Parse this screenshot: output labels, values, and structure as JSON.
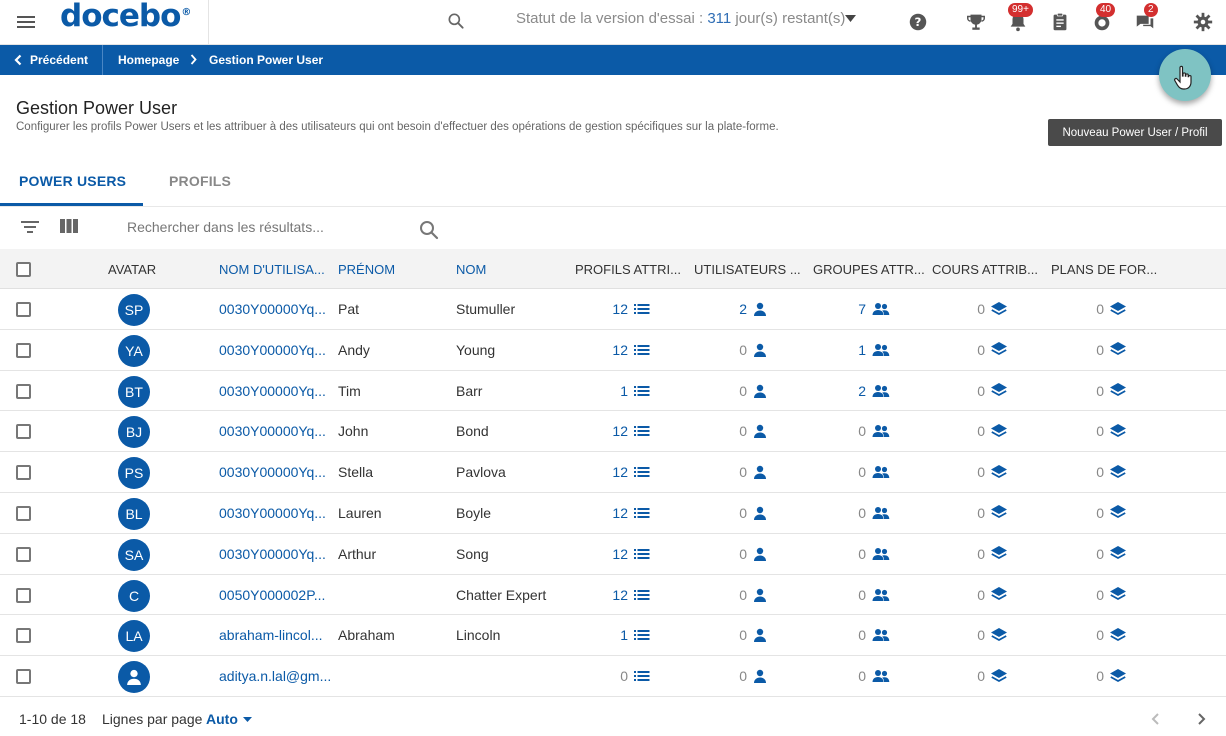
{
  "app": {
    "logo": "docebo",
    "logo_mark": "®",
    "trial_prefix": "Statut de la version d'essai : ",
    "trial_days": "311",
    "trial_suffix": " jour(s) restant(s)",
    "badges": {
      "notifications": "99+",
      "messages": "40",
      "chat": "2"
    }
  },
  "breadcrumb": {
    "back": "Précédent",
    "home": "Homepage",
    "current": "Gestion Power User"
  },
  "page": {
    "title": "Gestion Power User",
    "description": "Configurer les profils Power Users et les attribuer à des utilisateurs qui ont besoin d'effectuer des opérations de gestion spécifiques sur la plate-forme.",
    "new_button": "Nouveau Power User / Profil"
  },
  "tabs": [
    {
      "label": "POWER USERS"
    },
    {
      "label": "PROFILS"
    }
  ],
  "search": {
    "placeholder": "Rechercher dans les résultats..."
  },
  "table": {
    "columns": [
      "AVATAR",
      "NOM D'UTILISA...",
      "PRÉNOM",
      "NOM",
      "PROFILS ATTRI...",
      "UTILISATEURS ...",
      "GROUPES ATTR...",
      "COURS ATTRIB...",
      "PLANS DE FOR..."
    ],
    "rows": [
      {
        "avatar": "SP",
        "username": "0030Y00000Yq...",
        "first": "Pat",
        "last": "Stumuller",
        "profiles": "12",
        "users": "2",
        "groups": "7",
        "courses": "0",
        "plans": "0"
      },
      {
        "avatar": "YA",
        "username": "0030Y00000Yq...",
        "first": "Andy",
        "last": "Young",
        "profiles": "12",
        "users": "0",
        "groups": "1",
        "courses": "0",
        "plans": "0"
      },
      {
        "avatar": "BT",
        "username": "0030Y00000Yq...",
        "first": "Tim",
        "last": "Barr",
        "profiles": "1",
        "users": "0",
        "groups": "2",
        "courses": "0",
        "plans": "0"
      },
      {
        "avatar": "BJ",
        "username": "0030Y00000Yq...",
        "first": "John",
        "last": "Bond",
        "profiles": "12",
        "users": "0",
        "groups": "0",
        "courses": "0",
        "plans": "0"
      },
      {
        "avatar": "PS",
        "username": "0030Y00000Yq...",
        "first": "Stella",
        "last": "Pavlova",
        "profiles": "12",
        "users": "0",
        "groups": "0",
        "courses": "0",
        "plans": "0"
      },
      {
        "avatar": "BL",
        "username": "0030Y00000Yq...",
        "first": "Lauren",
        "last": "Boyle",
        "profiles": "12",
        "users": "0",
        "groups": "0",
        "courses": "0",
        "plans": "0"
      },
      {
        "avatar": "SA",
        "username": "0030Y00000Yq...",
        "first": "Arthur",
        "last": "Song",
        "profiles": "12",
        "users": "0",
        "groups": "0",
        "courses": "0",
        "plans": "0"
      },
      {
        "avatar": "C",
        "username": "0050Y000002P...",
        "first": "",
        "last": "Chatter Expert",
        "profiles": "12",
        "users": "0",
        "groups": "0",
        "courses": "0",
        "plans": "0"
      },
      {
        "avatar": "LA",
        "username": "abraham-lincol...",
        "first": "Abraham",
        "last": "Lincoln",
        "profiles": "1",
        "users": "0",
        "groups": "0",
        "courses": "0",
        "plans": "0"
      },
      {
        "avatar": "",
        "username": "aditya.n.lal@gm...",
        "first": "",
        "last": "",
        "profiles": "0",
        "users": "0",
        "groups": "0",
        "courses": "0",
        "plans": "0"
      }
    ]
  },
  "footer": {
    "pagination": "1-10 de 18",
    "rows_per_page_label": "Lignes par page",
    "rows_per_page_value": "Auto"
  },
  "colors": {
    "primary": "#0b5aa7",
    "fab": "#7fc3c3",
    "badge": "#d32f2f"
  }
}
